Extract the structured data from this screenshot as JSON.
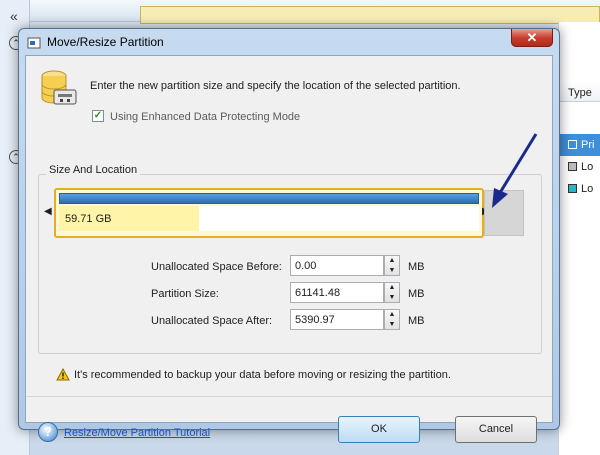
{
  "background": {
    "collapse_glyph": "«",
    "column_header": "Type",
    "rows": [
      {
        "label": "Pri",
        "color": "#3d8fd9",
        "selected": true
      },
      {
        "label": "Lo",
        "color": "#bdbdbd",
        "selected": false
      },
      {
        "label": "Lo",
        "color": "#2ab6c8",
        "selected": false
      }
    ]
  },
  "dialog": {
    "title": "Move/Resize Partition",
    "close_glyph": "✕",
    "intro": "Enter the new partition size and specify the location of the selected partition.",
    "checkbox_label": "Using Enhanced Data Protecting Mode",
    "checkbox_checked": true,
    "group_label": "Size And Location",
    "partition_size_label": "59.71 GB",
    "fields": [
      {
        "label": "Unallocated Space Before:",
        "value": "0.00",
        "unit": "MB"
      },
      {
        "label": "Partition Size:",
        "value": "61141.48",
        "unit": "MB"
      },
      {
        "label": "Unallocated Space After:",
        "value": "5390.97",
        "unit": "MB"
      }
    ],
    "warning": "It's recommended to backup your data before moving or resizing the partition.",
    "help_link": "Resize/Move Partition Tutorial",
    "ok_label": "OK",
    "cancel_label": "Cancel"
  },
  "colors": {
    "accent": "#2b6fb2",
    "partition_border": "#e6ad24",
    "annotation_arrow": "#1a2a8c"
  },
  "icons": {
    "handle_left": "◀",
    "handle_right": "▶",
    "spin_up": "▲",
    "spin_down": "▼",
    "warning": "warning-icon",
    "help": "help-icon"
  }
}
